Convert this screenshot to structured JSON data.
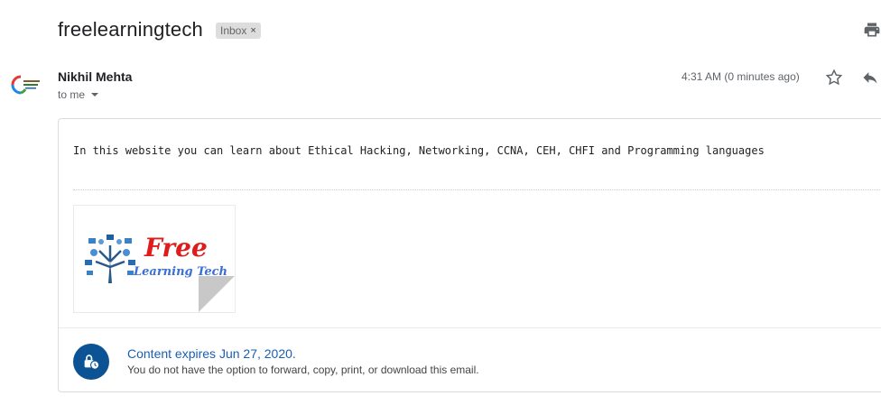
{
  "header": {
    "subject": "freelearningtech",
    "label": "Inbox",
    "label_close": "×"
  },
  "message": {
    "sender": "Nikhil Mehta",
    "recipient": "to me",
    "time": "4:31 AM (0 minutes ago)",
    "body": "In this website you can learn about Ethical Hacking, Networking, CCNA, CEH, CHFI and Programming languages",
    "attachment": {
      "logo_title": "Free",
      "logo_subtitle": "Learning Tech"
    },
    "expiration": {
      "title": "Content expires Jun 27, 2020.",
      "subtitle": "You do not have the option to forward, copy, print, or download this email."
    }
  },
  "icons": {
    "print": "print-icon",
    "star": "star-icon",
    "reply": "reply-icon",
    "expire": "lock-clock-icon"
  },
  "colors": {
    "accent_blue": "#1a5fb4",
    "expire_badge": "#0b5394",
    "logo_red": "#e01b1b"
  }
}
